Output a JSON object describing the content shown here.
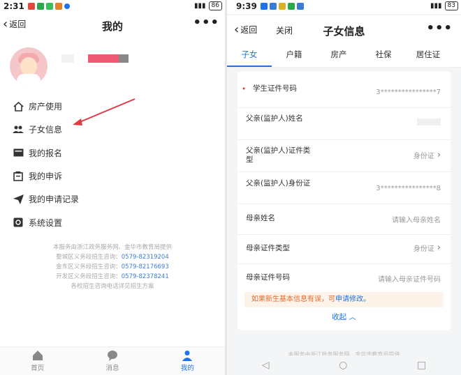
{
  "left": {
    "status": {
      "time": "2:31",
      "battery": "86"
    },
    "nav": {
      "back_label": "返回",
      "title": "我的",
      "more": "•••"
    },
    "menu": [
      {
        "label": "房产使用",
        "icon": "house-icon"
      },
      {
        "label": "子女信息",
        "icon": "children-icon"
      },
      {
        "label": "我的报名",
        "icon": "card-icon"
      },
      {
        "label": "我的申诉",
        "icon": "complaint-icon"
      },
      {
        "label": "我的申请记录",
        "icon": "send-icon"
      },
      {
        "label": "系统设置",
        "icon": "gear-icon"
      }
    ],
    "footer": {
      "line1": "本服务由浙江政务服务网、金华市教育局提供",
      "line2_prefix": "婺城区义务段招生咨询：",
      "line2_tel": "0579-82319204",
      "line3_prefix": "金东区义务段招生咨询：",
      "line3_tel": "0579-82176693",
      "line4_prefix": "开发区义务段招生咨询：",
      "line4_tel": "0579-82378241",
      "line5": "各校招生咨询电话详见招生方案"
    },
    "tabs": [
      {
        "label": "首页",
        "icon": "home-icon"
      },
      {
        "label": "消息",
        "icon": "message-icon"
      },
      {
        "label": "我的",
        "icon": "user-icon"
      }
    ]
  },
  "right": {
    "status": {
      "time": "9:39",
      "battery": "83"
    },
    "nav": {
      "back_label": "返回",
      "close_label": "关闭",
      "title": "子女信息",
      "more": "•••"
    },
    "tabs": [
      "子女",
      "户籍",
      "房产",
      "社保",
      "居住证"
    ],
    "rows": [
      {
        "label": "学生证件号码",
        "value": "3****************7",
        "required": true
      },
      {
        "label": "父亲(监护人)姓名",
        "value": "",
        "required": false
      },
      {
        "label": "父亲(监护人)证件类型",
        "value": "身份证",
        "required": false
      },
      {
        "label": "父亲(监护人)身份证",
        "value": "3****************8",
        "required": false
      },
      {
        "label": "母亲姓名",
        "value": "请输入母亲姓名",
        "required": false
      },
      {
        "label": "母亲证件类型",
        "value": "身份证",
        "required": false
      },
      {
        "label": "母亲证件号码",
        "value": "请输入母亲证件号码",
        "required": false
      }
    ],
    "notice": {
      "text": "如果新生基本信息有误，可",
      "link": "申请修改。"
    },
    "collapse_label": "收起",
    "footer": "本服务由浙江政务服务网、金华市教育局提供"
  },
  "colors": {
    "accent": "#1e73e8",
    "arrow": "#e03a47",
    "notice_bg": "#fdf3e9",
    "notice_text": "#e36b2d"
  }
}
